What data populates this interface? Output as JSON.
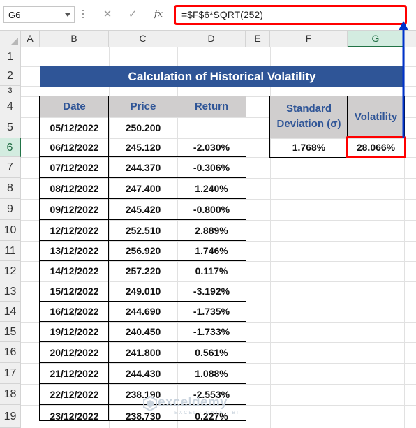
{
  "namebox": "G6",
  "formula": "=$F$6*SQRT(252)",
  "columns": [
    "A",
    "B",
    "C",
    "D",
    "E",
    "F",
    "G"
  ],
  "rows": [
    "1",
    "2",
    "3",
    "4",
    "5",
    "6",
    "7",
    "8",
    "9",
    "10",
    "11",
    "12",
    "13",
    "14",
    "15",
    "16",
    "17",
    "18",
    "19"
  ],
  "title": "Calculation of Historical Volatility",
  "table": {
    "headers": [
      "Date",
      "Price",
      "Return"
    ],
    "rows": [
      [
        "05/12/2022",
        "250.200",
        ""
      ],
      [
        "06/12/2022",
        "245.120",
        "-2.030%"
      ],
      [
        "07/12/2022",
        "244.370",
        "-0.306%"
      ],
      [
        "08/12/2022",
        "247.400",
        "1.240%"
      ],
      [
        "09/12/2022",
        "245.420",
        "-0.800%"
      ],
      [
        "12/12/2022",
        "252.510",
        "2.889%"
      ],
      [
        "13/12/2022",
        "256.920",
        "1.746%"
      ],
      [
        "14/12/2022",
        "257.220",
        "0.117%"
      ],
      [
        "15/12/2022",
        "249.010",
        "-3.192%"
      ],
      [
        "16/12/2022",
        "244.690",
        "-1.735%"
      ],
      [
        "19/12/2022",
        "240.450",
        "-1.733%"
      ],
      [
        "20/12/2022",
        "241.800",
        "0.561%"
      ],
      [
        "21/12/2022",
        "244.430",
        "1.088%"
      ],
      [
        "22/12/2022",
        "238.190",
        "-2.553%"
      ],
      [
        "23/12/2022",
        "238.730",
        "0.227%"
      ]
    ]
  },
  "summary": {
    "sd_label_1": "Standard",
    "sd_label_2": "Deviation (σ)",
    "vol_label": "Volatility",
    "sd_value": "1.768%",
    "vol_value": "28.066%"
  },
  "watermark": {
    "name": "exceldemy",
    "tagline": "EXCEL · DATA · BI"
  },
  "colors": {
    "title_bg": "#2f5597",
    "header_bg": "#d0cece",
    "highlight": "#ff0000",
    "arrow": "#0033cc",
    "selection": "#217346"
  },
  "icons": [
    "dropdown-icon",
    "cancel-icon",
    "enter-icon",
    "function-icon",
    "arrow-icon"
  ]
}
